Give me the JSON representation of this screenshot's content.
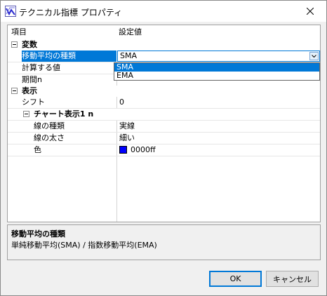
{
  "window": {
    "title": "テクニカル指標 プロパティ",
    "close_glyph": "✕"
  },
  "grid": {
    "header_name": "項目",
    "header_value": "設定値",
    "category_variables": "変数",
    "rows": {
      "ma_type_name": "移動平均の種類",
      "ma_type_value": "SMA",
      "calc_value_name": "計算する値",
      "period_name": "期間n",
      "category_display": "表示",
      "shift_name": "シフト",
      "shift_value": "0",
      "chart_group_name": "チャート表示1 n",
      "line_type_name": "線の種類",
      "line_type_value": "実線",
      "line_width_name": "線の太さ",
      "line_width_value": "細い",
      "color_name": "色",
      "color_value": "0000ff",
      "color_hex": "#0000ff"
    },
    "dropdown_options": [
      "SMA",
      "EMA"
    ],
    "dropdown_selected": "SMA"
  },
  "description": {
    "title": "移動平均の種類",
    "text": "単純移動平均(SMA) / 指数移動平均(EMA)"
  },
  "buttons": {
    "ok": "OK",
    "cancel": "キャンセル"
  },
  "colors": {
    "selection": "#0078d7",
    "window_bg": "#f0f0f0"
  }
}
